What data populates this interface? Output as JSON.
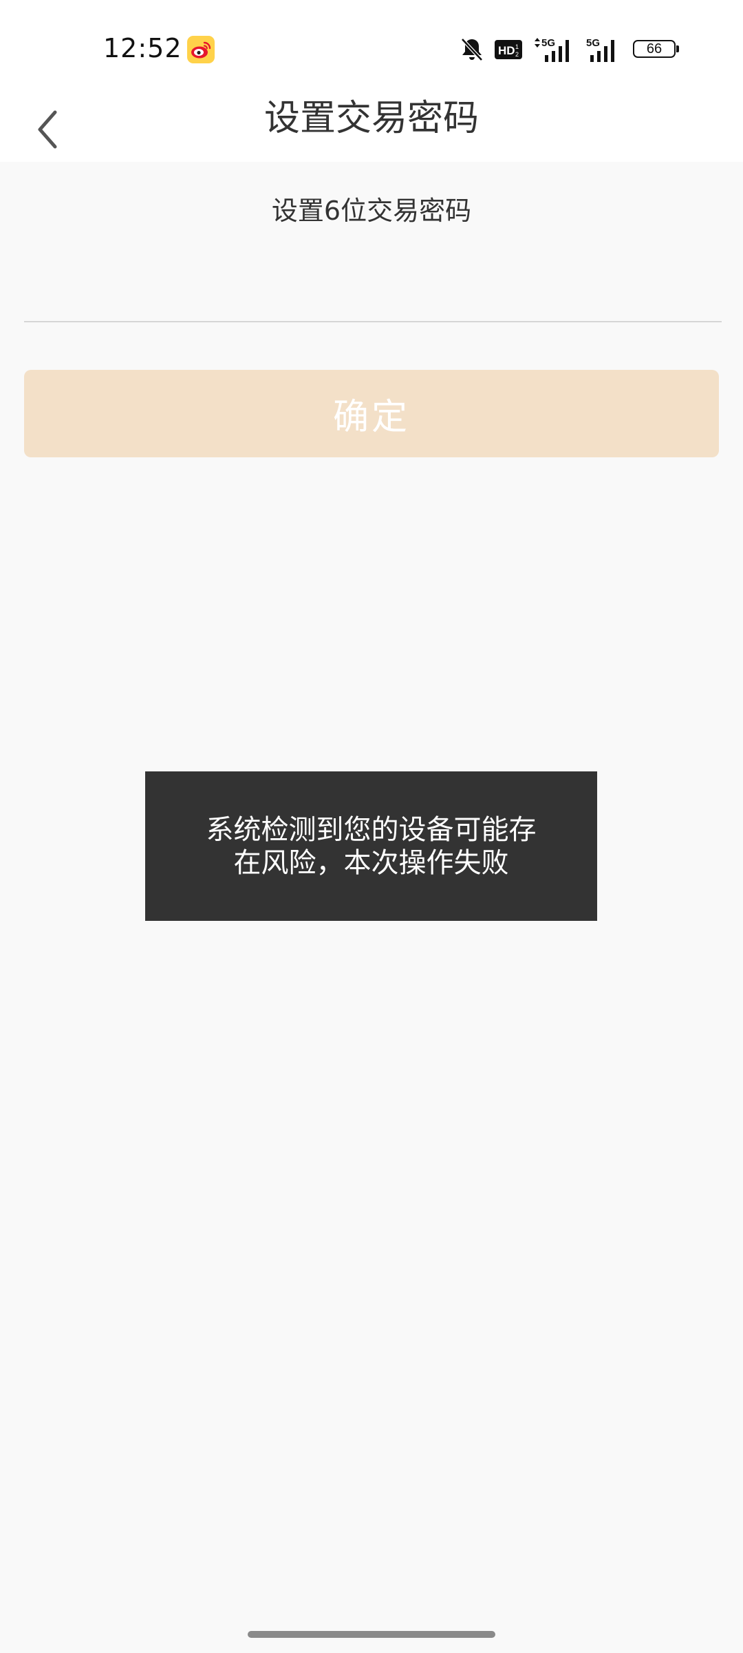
{
  "status_bar": {
    "time": "12:52",
    "battery": "66",
    "icons": [
      "weibo-icon",
      "bell-muted-icon",
      "hd-icon",
      "signal-5g-icon",
      "signal-5g-icon",
      "battery-icon"
    ]
  },
  "header": {
    "title": "设置交易密码",
    "back_icon": "chevron-left-icon"
  },
  "form": {
    "subtitle": "设置6位交易密码",
    "password_value": "",
    "confirm_label": "确定",
    "confirm_color": "#f3e0c8"
  },
  "toast": {
    "message": "系统检测到您的设备可能存在风险，本次操作失败"
  }
}
